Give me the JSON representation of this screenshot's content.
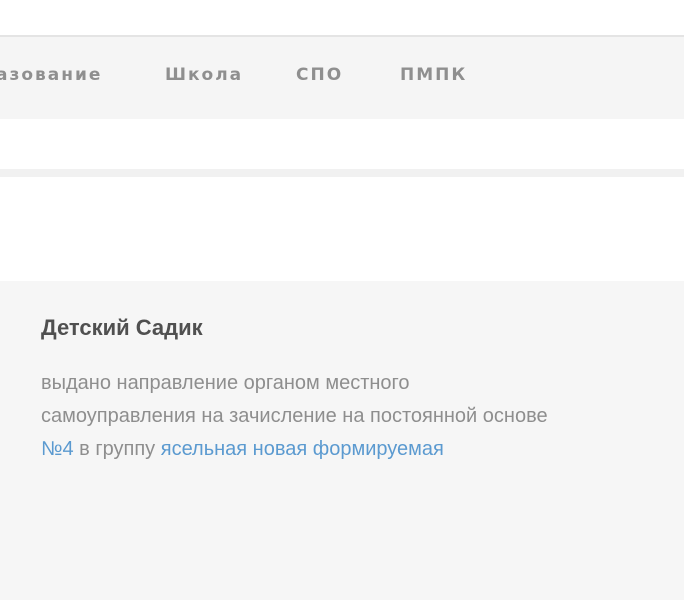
{
  "nav": {
    "items": [
      {
        "label": "азование"
      },
      {
        "label": "Школа"
      },
      {
        "label": "СПО"
      },
      {
        "label": "ПМПК"
      }
    ]
  },
  "status_card": {
    "title": "Детский Садик",
    "text_line1": "выдано направление органом местного",
    "text_line2": "самоуправления на зачисление на постоянной основе",
    "institution_link": "№4",
    "text_middle": "в группу",
    "group_link": "ясельная новая формируемая"
  },
  "colors": {
    "link": "#5b9ad0",
    "nav_text": "#8f8f8f",
    "title": "#505050",
    "body_text": "#8e8e8e",
    "card_bg": "#f6f6f6",
    "nav_bg": "#f5f5f5"
  }
}
